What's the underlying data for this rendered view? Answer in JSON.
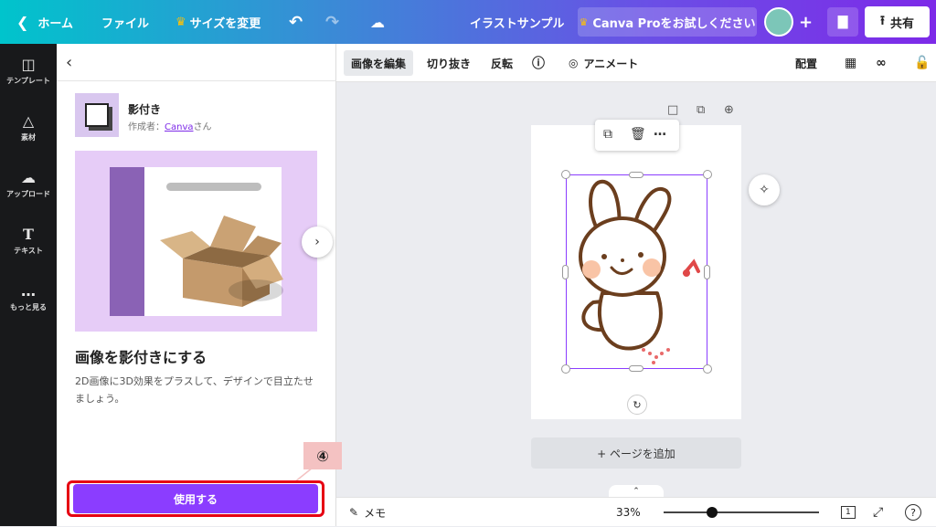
{
  "topbar": {
    "home": "ホーム",
    "file": "ファイル",
    "resize": "サイズを変更",
    "title": "イラストサンプル",
    "pro": "Canva Proをお試しください",
    "share": "共有"
  },
  "rail": {
    "items": [
      {
        "label": "テンプレート",
        "icon": "template-icon"
      },
      {
        "label": "素材",
        "icon": "elements-icon"
      },
      {
        "label": "アップロード",
        "icon": "upload-icon"
      },
      {
        "label": "テキスト",
        "icon": "text-icon"
      },
      {
        "label": "もっと見る",
        "icon": "more-icon"
      }
    ]
  },
  "panel": {
    "effect_name": "影付き",
    "author_prefix": "作成者：",
    "author_link": "Canva",
    "author_suffix": "さん",
    "title": "画像を影付きにする",
    "description": "2D画像に3D効果をプラスして、デザインで目立たせましょう。",
    "step": "④",
    "use_button": "使用する"
  },
  "toolbar": {
    "edit_image": "画像を編集",
    "crop": "切り抜き",
    "flip": "反転",
    "animate": "アニメート",
    "position": "配置"
  },
  "canvas": {
    "add_page": "+ ページを追加"
  },
  "bottombar": {
    "notes": "メモ",
    "zoom": "33%",
    "zoom_level": 0.33,
    "page_count": "1",
    "help": "?"
  },
  "colors": {
    "accent": "#8b3dff",
    "highlight": "#e60012",
    "step_badge": "#f4c2c2"
  }
}
